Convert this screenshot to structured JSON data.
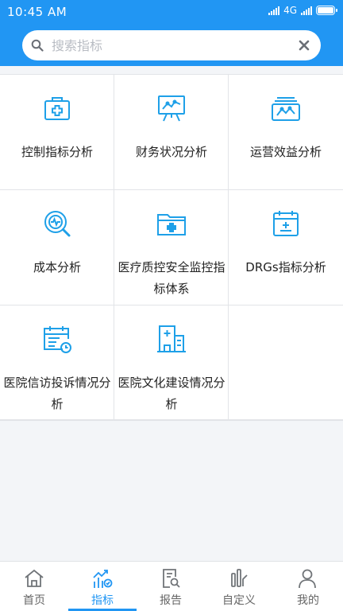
{
  "status_bar": {
    "time": "10:45 AM",
    "network": "4G"
  },
  "search": {
    "placeholder": "搜索指标"
  },
  "grid": {
    "items": [
      {
        "label": "控制指标分析",
        "icon": "first-aid-kit-icon"
      },
      {
        "label": "财务状况分析",
        "icon": "presentation-chart-icon"
      },
      {
        "label": "运营效益分析",
        "icon": "stacked-trend-icon"
      },
      {
        "label": "成本分析",
        "icon": "magnify-pulse-icon"
      },
      {
        "label": "医疗质控安全监控指标体系",
        "icon": "medical-folder-icon"
      },
      {
        "label": "DRGs指标分析",
        "icon": "calendar-plus-icon"
      },
      {
        "label": "医院信访投诉情况分析",
        "icon": "calendar-clock-icon"
      },
      {
        "label": "医院文化建设情况分析",
        "icon": "hospital-building-icon"
      }
    ]
  },
  "tabbar": {
    "tabs": [
      {
        "label": "首页",
        "icon": "home-icon",
        "active": false
      },
      {
        "label": "指标",
        "icon": "indicator-chart-icon",
        "active": true
      },
      {
        "label": "报告",
        "icon": "report-search-icon",
        "active": false
      },
      {
        "label": "自定义",
        "icon": "custom-bars-icon",
        "active": false
      },
      {
        "label": "我的",
        "icon": "user-icon",
        "active": false
      }
    ]
  },
  "colors": {
    "accent": "#2196f3",
    "icon_blue": "#1ea0e8"
  }
}
